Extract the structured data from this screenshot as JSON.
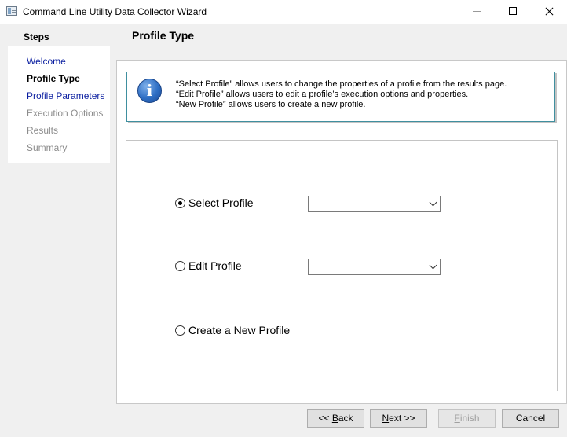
{
  "window": {
    "title": "Command Line Utility Data Collector Wizard",
    "icon": "app-window-icon"
  },
  "steps": {
    "heading": "Steps",
    "items": [
      {
        "label": "Welcome",
        "state": "link"
      },
      {
        "label": "Profile Type",
        "state": "current"
      },
      {
        "label": "Profile Parameters",
        "state": "link"
      },
      {
        "label": "Execution Options",
        "state": "disabled"
      },
      {
        "label": "Results",
        "state": "disabled"
      },
      {
        "label": "Summary",
        "state": "disabled"
      }
    ]
  },
  "page": {
    "title": "Profile Type"
  },
  "info": {
    "icon": "info-icon",
    "lines": [
      "“Select Profile” allows users to change the properties of a profile from the results page.",
      "“Edit Profile” allows users to edit a profile’s execution options and properties.",
      "“New Profile” allows users to create a new profile."
    ]
  },
  "options": {
    "select_profile": {
      "label": "Select Profile",
      "checked": true,
      "value": ""
    },
    "edit_profile": {
      "label": "Edit Profile",
      "checked": false,
      "value": ""
    },
    "new_profile": {
      "label": "Create a New Profile",
      "checked": false
    }
  },
  "buttons": {
    "back": {
      "prefix": "<< ",
      "accel": "B",
      "rest": "ack"
    },
    "next": {
      "accel": "N",
      "rest": "ext >>"
    },
    "finish": {
      "accel": "F",
      "rest": "inish",
      "enabled": false
    },
    "cancel": {
      "label": "Cancel"
    }
  }
}
